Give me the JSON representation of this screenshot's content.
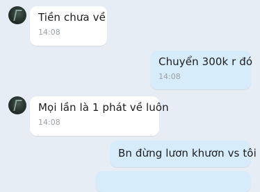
{
  "conversation": {
    "messages": [
      {
        "direction": "incoming",
        "text": "Tiền chưa về",
        "time": "14:08"
      },
      {
        "direction": "outgoing",
        "text": "Chuyển 300k r đó",
        "time": "14:08"
      },
      {
        "direction": "incoming",
        "text": "Mọi lần là 1 phát về luôn",
        "time": "14:08"
      },
      {
        "direction": "outgoing",
        "text": "Bn đừng lươn khươn vs tôi",
        "time": ""
      }
    ]
  },
  "colors": {
    "background": "#e7edf4",
    "incoming_bubble": "#ffffff",
    "outgoing_bubble": "#d6ecfb",
    "time_text": "#9aa0a6"
  }
}
